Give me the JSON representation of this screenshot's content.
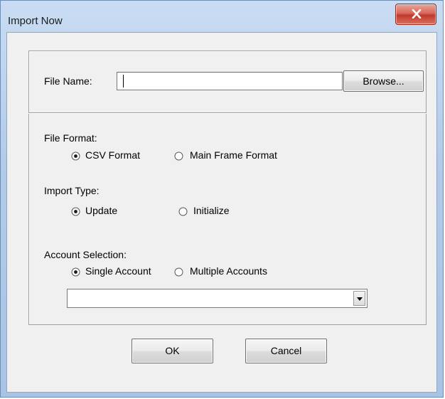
{
  "window": {
    "title": "Import Now"
  },
  "file": {
    "label": "File Name:",
    "value": "",
    "browse_label": "Browse..."
  },
  "file_format": {
    "label": "File Format:",
    "options": [
      "CSV Format",
      "Main Frame Format"
    ],
    "selected": "CSV Format"
  },
  "import_type": {
    "label": "Import Type:",
    "options": [
      "Update",
      "Initialize"
    ],
    "selected": "Update"
  },
  "account_selection": {
    "label": "Account Selection:",
    "options": [
      "Single Account",
      "Multiple Accounts"
    ],
    "selected": "Single Account",
    "dropdown_value": ""
  },
  "buttons": {
    "ok_label": "OK",
    "cancel_label": "Cancel"
  },
  "colors": {
    "close_button": "#c0392b",
    "window_frame": "#b3cbe9",
    "client_bg": "#f0f0f0"
  },
  "icons": {
    "close": "close-x-icon",
    "radio_selected": "radio-selected-icon",
    "radio_unselected": "radio-unselected-icon",
    "dropdown": "chevron-down-icon"
  }
}
